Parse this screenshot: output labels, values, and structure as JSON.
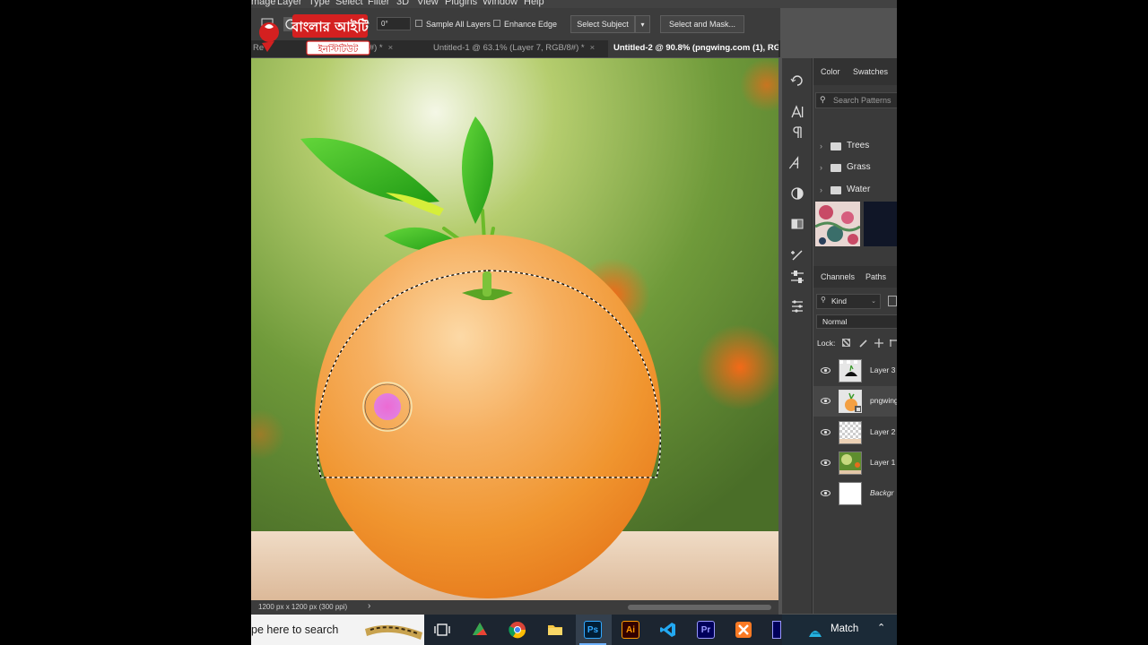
{
  "menu": [
    "mage",
    "Layer",
    "Type",
    "Select",
    "Filter",
    "3D",
    "View",
    "Plugins",
    "Window",
    "Help"
  ],
  "logo": {
    "line1": "বাংলার আইটি",
    "line2": "ইনস্টিটিউট"
  },
  "options": {
    "angle_value": "0°",
    "sample_all_layers": "Sample All Layers",
    "enhance_edge": "Enhance Edge",
    "select_subject": "Select Subject",
    "select_and_mask": "Select and Mask..."
  },
  "tabs": [
    {
      "label": "Re",
      "suffix": "GB/8#) *",
      "close": "×"
    },
    {
      "label": "Untitled-1 @ 63.1% (Layer 7, RGB/8#) *",
      "close": "×"
    },
    {
      "label": "Untitled-2 @ 90.8% (pngwing.com (1), RG"
    }
  ],
  "status": {
    "doc_size": "1200 px x 1200 px (300 ppi)",
    "arrow": "›"
  },
  "panels": {
    "tab_color": "Color",
    "tab_swatches": "Swatches",
    "search_placeholder": "Search Patterns",
    "pattern_folders": [
      "Trees",
      "Grass",
      "Water"
    ],
    "tab_channels": "Channels",
    "tab_paths": "Paths",
    "kind": "Kind",
    "blend_mode": "Normal",
    "lock_label": "Lock:",
    "layers": [
      {
        "name": "Layer 3",
        "italic": false
      },
      {
        "name": "pngwing",
        "italic": false
      },
      {
        "name": "Layer 2",
        "italic": false
      },
      {
        "name": "Layer 1",
        "italic": false
      },
      {
        "name": "Backgr",
        "italic": true
      }
    ]
  },
  "taskbar": {
    "search_text": "pe here to search",
    "apps": [
      "task-view",
      "docs",
      "chrome",
      "file-explorer",
      "photoshop",
      "illustrator",
      "vscode",
      "premiere",
      "xampp"
    ],
    "ps_label": "Ps",
    "ai_label": "Ai",
    "pr_label": "Pr",
    "weather": "Match"
  },
  "colors": {
    "ps_panel": "#3a3a3a",
    "accent_orange": "#f28a1e",
    "selection_marquee": "#000000",
    "brush_cursor": "#e86bd0"
  }
}
